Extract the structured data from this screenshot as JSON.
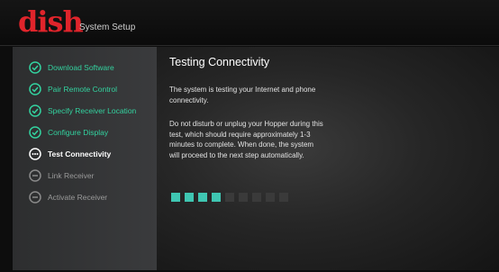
{
  "header": {
    "logo_text": "dish",
    "subtitle": "System Setup"
  },
  "sidebar": {
    "steps": [
      {
        "label": "Download Software",
        "status": "done"
      },
      {
        "label": "Pair Remote Control",
        "status": "done"
      },
      {
        "label": "Specify Receiver Location",
        "status": "done"
      },
      {
        "label": "Configure Display",
        "status": "done"
      },
      {
        "label": "Test Connectivity",
        "status": "current"
      },
      {
        "label": "Link Receiver",
        "status": "pending"
      },
      {
        "label": "Activate Receiver",
        "status": "pending"
      }
    ]
  },
  "main": {
    "title": "Testing Connectivity",
    "paragraph1": "The system is testing your Internet and phone connectivity.",
    "paragraph2": "Do not disturb or unplug your Hopper during this test, which should require approximately 1-3 minutes to complete. When done, the system will proceed to the next step automatically.",
    "progress": {
      "filled_segments": 4,
      "total_segments": 9
    }
  },
  "colors": {
    "brand_red": "#e0242b",
    "done_green": "#33d29f",
    "progress_teal": "#3fc6b2"
  }
}
